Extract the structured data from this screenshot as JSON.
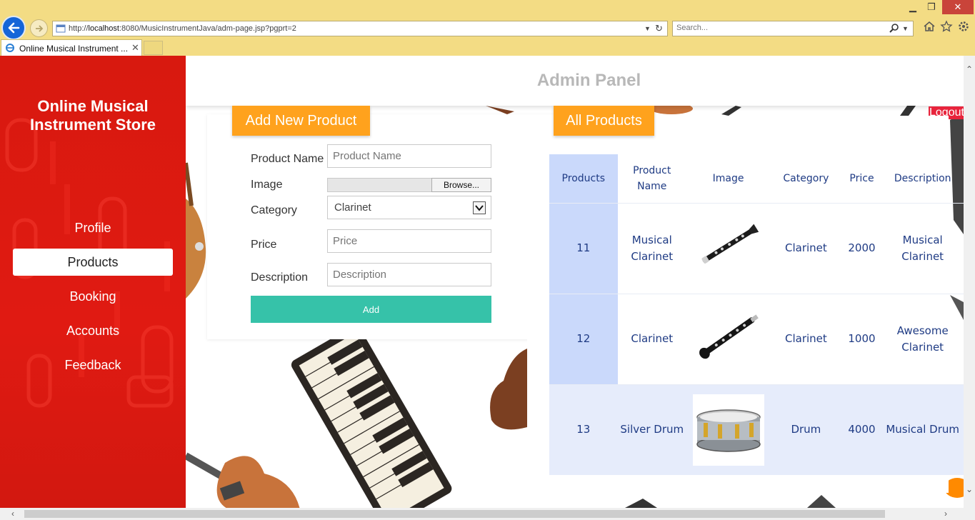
{
  "browser": {
    "url_prefix": "http://",
    "url_host": "localhost",
    "url_rest": ":8080/MusicInstrumentJava/adm-page.jsp?pgprt=2",
    "search_placeholder": "Search...",
    "tab_title": "Online Musical Instrument ...",
    "icons": [
      "back-icon",
      "forward-icon",
      "refresh-icon",
      "search-icon",
      "home-icon",
      "star-icon",
      "gear-icon",
      "minimize-icon",
      "restore-icon",
      "close-icon"
    ]
  },
  "sidebar": {
    "brand_line1": "Online Musical",
    "brand_line2": "Instrument Store",
    "items": [
      {
        "label": "Profile",
        "active": false
      },
      {
        "label": "Products",
        "active": true
      },
      {
        "label": "Booking",
        "active": false
      },
      {
        "label": "Accounts",
        "active": false
      },
      {
        "label": "Feedback",
        "active": false
      }
    ]
  },
  "header": {
    "title": "Admin Panel",
    "logout_label": "Logout"
  },
  "add_form": {
    "heading": "Add New Product",
    "product_name_label": "Product Name",
    "product_name_placeholder": "Product Name",
    "image_label": "Image",
    "browse_label": "Browse...",
    "category_label": "Category",
    "category_value": "Clarinet",
    "price_label": "Price",
    "price_placeholder": "Price",
    "description_label": "Description",
    "description_placeholder": "Description",
    "add_label": "Add"
  },
  "products": {
    "heading": "All Products",
    "columns": [
      "Products",
      "Product Name",
      "Image",
      "Category",
      "Price",
      "Description"
    ],
    "rows": [
      {
        "id": "11",
        "name": "Musical Clarinet",
        "image": "clarinet-image",
        "category": "Clarinet",
        "price": "2000",
        "description": "Musical Clarinet"
      },
      {
        "id": "12",
        "name": "Clarinet",
        "image": "clarinet-image",
        "category": "Clarinet",
        "price": "1000",
        "description": "Awesome Clarinet"
      },
      {
        "id": "13",
        "name": "Silver Drum",
        "image": "drum-image",
        "category": "Drum",
        "price": "4000",
        "description": "Musical Drum"
      }
    ]
  },
  "colors": {
    "sidebar_red": "#e01a12",
    "accent_orange": "#ffa21d",
    "add_button_teal": "#36c2a9",
    "table_text_blue": "#1f3b84",
    "id_column_blue": "#cad9fb",
    "logout_red": "#e8243c"
  }
}
